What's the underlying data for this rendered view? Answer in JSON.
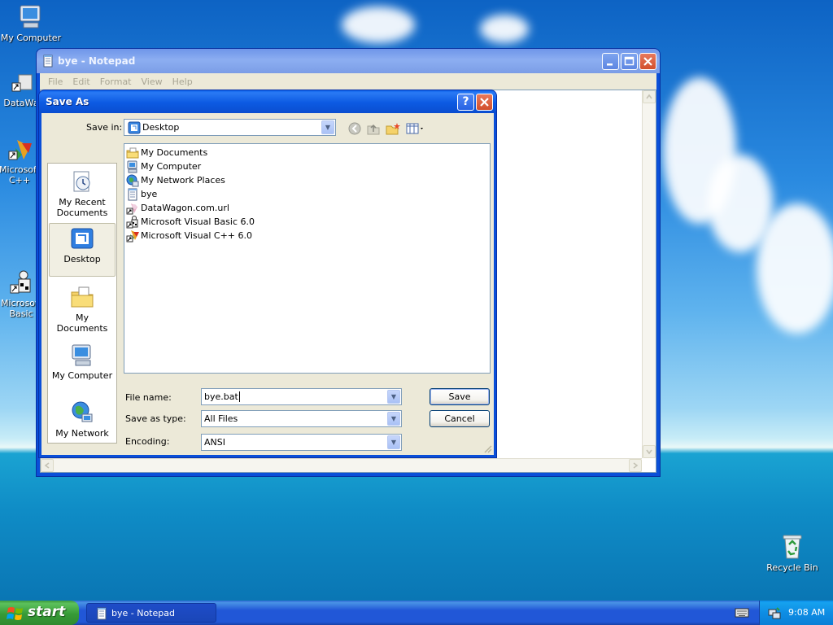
{
  "desktop": {
    "icons": {
      "my_computer": "My Computer",
      "datawagon": "DataWa",
      "vc_line1": "Microsoft",
      "vc_line2": "C++",
      "vb_line1": "Microsoft",
      "vb_line2": "Basic",
      "recycle_bin": "Recycle Bin"
    }
  },
  "notepad": {
    "title": "bye - Notepad",
    "menu": [
      "File",
      "Edit",
      "Format",
      "View",
      "Help"
    ]
  },
  "dialog": {
    "title": "Save As",
    "save_in_label": "Save in:",
    "save_in_value": "Desktop",
    "places": {
      "recent_line1": "My Recent",
      "recent_line2": "Documents",
      "desktop": "Desktop",
      "my_documents": "My Documents",
      "my_computer": "My Computer",
      "my_network": "My Network"
    },
    "files": [
      "My Documents",
      "My Computer",
      "My Network Places",
      "bye",
      "DataWagon.com.url",
      "Microsoft Visual Basic 6.0",
      "Microsoft Visual C++ 6.0"
    ],
    "file_name_label": "File name:",
    "file_name_value": "bye.bat",
    "save_type_label": "Save as type:",
    "save_type_value": "All Files",
    "encoding_label": "Encoding:",
    "encoding_value": "ANSI",
    "save_button": "Save",
    "cancel_button": "Cancel",
    "help_glyph": "?"
  },
  "taskbar": {
    "start_label": "start",
    "task_label": "bye - Notepad",
    "clock": "9:08 AM"
  }
}
